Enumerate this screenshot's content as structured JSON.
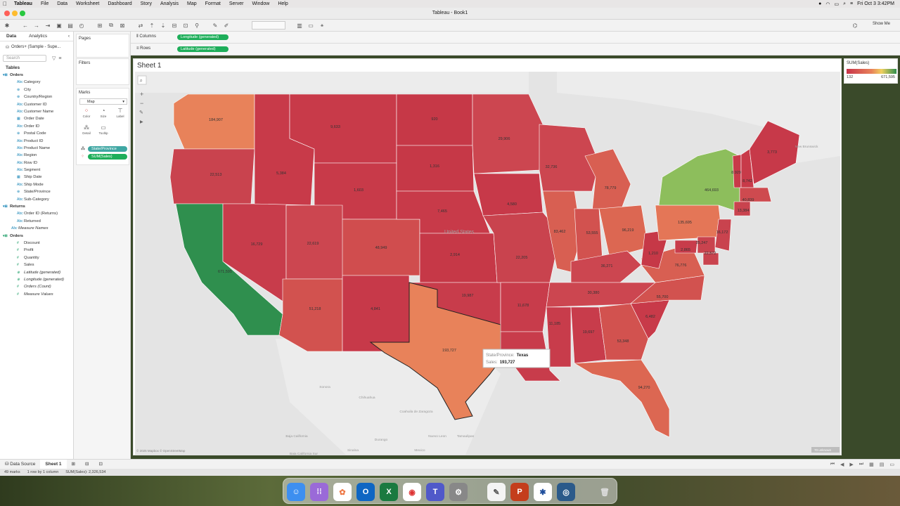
{
  "menubar": {
    "app": "Tableau",
    "items": [
      "File",
      "Data",
      "Worksheet",
      "Dashboard",
      "Story",
      "Analysis",
      "Map",
      "Format",
      "Server",
      "Window",
      "Help"
    ],
    "clock": "Fri Oct 3  3:42PM"
  },
  "window": {
    "title": "Tableau - Book1"
  },
  "toolbar": {
    "show_me": "Show Me"
  },
  "data_pane": {
    "tabs": [
      "Data",
      "Analytics"
    ],
    "source": "Orders+ (Sample - Supe...",
    "search_placeholder": "Search",
    "tables_label": "Tables",
    "orders_table": "Orders",
    "orders_fields": [
      "Category",
      "City",
      "Country/Region",
      "Customer ID",
      "Customer Name",
      "Order Date",
      "Order ID",
      "Postal Code",
      "Product ID",
      "Product Name",
      "Region",
      "Row ID",
      "Segment",
      "Ship Date",
      "Ship Mode",
      "State/Province",
      "Sub-Category"
    ],
    "returns_table": "Returns",
    "returns_fields": [
      "Order ID (Returns)",
      "Returned"
    ],
    "measure_names": "Measure Names",
    "orders_measures_table": "Orders",
    "measures": [
      "Discount",
      "Profit",
      "Quantity",
      "Sales"
    ],
    "generated": [
      "Latitude (generated)",
      "Longitude (generated)",
      "Orders (Count)",
      "Measure Values"
    ]
  },
  "shelves": {
    "pages": "Pages",
    "filters": "Filters",
    "marks": "Marks",
    "mark_type": "Map",
    "mark_buttons": [
      "Color",
      "Size",
      "Label",
      "Detail",
      "Tooltip"
    ],
    "mark_pills": [
      "State/Province",
      "SUM(Sales)"
    ],
    "columns_label": "Columns",
    "columns_pill": "Longitude (generated)",
    "rows_label": "Rows",
    "rows_pill": "Latitude (generated)"
  },
  "sheet": {
    "title": "Sheet 1"
  },
  "legend": {
    "title": "SUM(Sales)",
    "min": "132",
    "max": "671,595"
  },
  "map": {
    "country_label": "United States",
    "place_labels": [
      "New Brunswick",
      "Sonora",
      "Chihuahua",
      "Coahuila de Zaragoza",
      "Nuevo Leon",
      "Baja California",
      "Baja California Sur",
      "Sinaloa",
      "Durango",
      "Tamaulipas",
      "Mexico"
    ],
    "attribution": "© 2025 Mapbox © OpenStreetMap",
    "unknown_badge": "70 unknown",
    "state_labels": [
      {
        "state": "Washington",
        "value": "184,907",
        "color": "#e8825a"
      },
      {
        "state": "Oregon",
        "value": "22,513",
        "color": "#c9434e"
      },
      {
        "state": "California",
        "value": "671,595",
        "color": "#2f8f4e"
      },
      {
        "state": "Nevada",
        "value": "16,729",
        "color": "#c83c4b"
      },
      {
        "state": "Idaho",
        "value": "5,384",
        "color": "#c83a49"
      },
      {
        "state": "Montana",
        "value": "9,633",
        "color": "#c83a49"
      },
      {
        "state": "Wyoming",
        "value": "1,603",
        "color": "#c83a49"
      },
      {
        "state": "Utah",
        "value": "22,619",
        "color": "#cc4650"
      },
      {
        "state": "Arizona",
        "value": "51,218",
        "color": "#d2524f"
      },
      {
        "state": "Colorado",
        "value": "48,949",
        "color": "#d04d4e"
      },
      {
        "state": "New Mexico",
        "value": "4,841",
        "color": "#c73949"
      },
      {
        "state": "North Dakota",
        "value": "920",
        "color": "#c63847"
      },
      {
        "state": "South Dakota",
        "value": "1,316",
        "color": "#c63847"
      },
      {
        "state": "Nebraska",
        "value": "7,465",
        "color": "#c83a49"
      },
      {
        "state": "Kansas",
        "value": "2,914",
        "color": "#c63847"
      },
      {
        "state": "Oklahoma",
        "value": "19,987",
        "color": "#c83c4b"
      },
      {
        "state": "Texas",
        "value": "193,727",
        "color": "#e8825a"
      },
      {
        "state": "Minnesota",
        "value": "29,906",
        "color": "#cc4650"
      },
      {
        "state": "Iowa",
        "value": "4,580",
        "color": "#c73949"
      },
      {
        "state": "Missouri",
        "value": "22,205",
        "color": "#c9434e"
      },
      {
        "state": "Arkansas",
        "value": "11,678",
        "color": "#c83c4b"
      },
      {
        "state": "Louisiana",
        "value": "9,217",
        "color": "#c83c4b"
      },
      {
        "state": "Wisconsin",
        "value": "32,736",
        "color": "#cc4650"
      },
      {
        "state": "Illinois",
        "value": "83,462",
        "color": "#d85f52"
      },
      {
        "state": "Michigan",
        "value": "78,779",
        "color": "#d85f52"
      },
      {
        "state": "Indiana",
        "value": "53,555",
        "color": "#d2524f"
      },
      {
        "state": "Ohio",
        "value": "96,219",
        "color": "#dc6752"
      },
      {
        "state": "Kentucky",
        "value": "36,271",
        "color": "#cc4650"
      },
      {
        "state": "Tennessee",
        "value": "30,380",
        "color": "#cc4650"
      },
      {
        "state": "Mississippi",
        "value": "11,185",
        "color": "#c83c4b"
      },
      {
        "state": "Alabama",
        "value": "19,697",
        "color": "#c83c4b"
      },
      {
        "state": "Georgia",
        "value": "53,348",
        "color": "#d2524f"
      },
      {
        "state": "Florida",
        "value": "94,270",
        "color": "#dc6752"
      },
      {
        "state": "South Carolina",
        "value": "6,482",
        "color": "#c83a49"
      },
      {
        "state": "North Carolina",
        "value": "55,700",
        "color": "#d2524f"
      },
      {
        "state": "Virginia",
        "value": "76,776",
        "color": "#d85f52"
      },
      {
        "state": "West Virginia",
        "value": "1,210",
        "color": "#c63847"
      },
      {
        "state": "Pennsylvania",
        "value": "135,695",
        "color": "#e47657"
      },
      {
        "state": "New York",
        "value": "464,693",
        "color": "#8dbe5c"
      },
      {
        "state": "Vermont",
        "value": "8,929",
        "color": "#c83a49"
      },
      {
        "state": "New Hampshire",
        "value": "8,742",
        "color": "#c83a49"
      },
      {
        "state": "Maine",
        "value": "3,773",
        "color": "#c73949"
      },
      {
        "state": "Massachusetts",
        "value": "40,839",
        "color": "#ce4a4f"
      },
      {
        "state": "Connecticut",
        "value": "13,384",
        "color": "#c9434e"
      },
      {
        "state": "New Jersey",
        "value": "16,172",
        "color": "#c9434e"
      },
      {
        "state": "Maryland",
        "value": "2,865",
        "color": "#c83c4b"
      },
      {
        "state": "Delaware",
        "value": "25,247",
        "color": "#c9434e"
      },
      {
        "state": "Rhode Island",
        "value": "22,572",
        "color": "#c9434e"
      }
    ],
    "tooltip": {
      "label1": "State/Province:",
      "value1": "Texas",
      "label2": "Sales:",
      "value2": "193,727"
    }
  },
  "bottom": {
    "tabs": [
      "Data Source",
      "Sheet 1"
    ]
  },
  "status": {
    "marks": "49 marks",
    "rows": "1 row by 1 column",
    "sum": "SUM(Sales): 2,326,534"
  },
  "colors": {
    "low": "#c8344a",
    "mid": "#e8825a",
    "high": "#2f8f4e",
    "pill_green": "#1eae5a",
    "pill_teal": "#3fa7a3"
  }
}
